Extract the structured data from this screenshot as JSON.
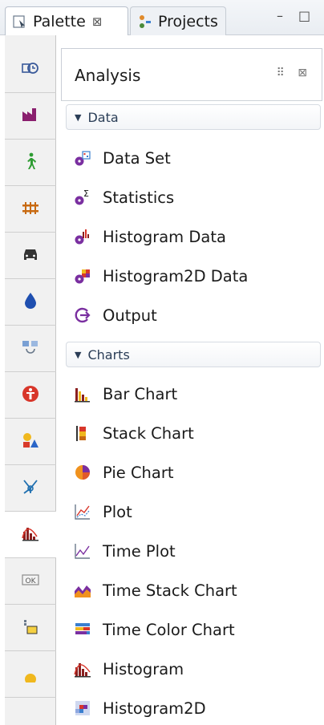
{
  "tabs": {
    "palette": {
      "label": "Palette",
      "close": "⊠"
    },
    "projects": {
      "label": "Projects"
    },
    "minimize": "–",
    "maximize": "□"
  },
  "panel": {
    "title": "Analysis",
    "header_buttons": "⠿ ⊠"
  },
  "sections": [
    {
      "label": "Data",
      "items": [
        {
          "label": "Data Set",
          "icon": "data-set-icon"
        },
        {
          "label": "Statistics",
          "icon": "statistics-icon"
        },
        {
          "label": "Histogram Data",
          "icon": "histogram-data-icon"
        },
        {
          "label": "Histogram2D Data",
          "icon": "histogram2d-data-icon"
        },
        {
          "label": "Output",
          "icon": "output-icon"
        }
      ]
    },
    {
      "label": "Charts",
      "items": [
        {
          "label": "Bar Chart",
          "icon": "bar-chart-icon"
        },
        {
          "label": "Stack Chart",
          "icon": "stack-chart-icon"
        },
        {
          "label": "Pie Chart",
          "icon": "pie-chart-icon"
        },
        {
          "label": "Plot",
          "icon": "plot-icon"
        },
        {
          "label": "Time Plot",
          "icon": "time-plot-icon"
        },
        {
          "label": "Time Stack Chart",
          "icon": "time-stack-chart-icon"
        },
        {
          "label": "Time Color Chart",
          "icon": "time-color-chart-icon"
        },
        {
          "label": "Histogram",
          "icon": "histogram-icon"
        },
        {
          "label": "Histogram2D",
          "icon": "histogram2d-icon"
        }
      ]
    }
  ],
  "strip": [
    {
      "icon": "timer-icon"
    },
    {
      "icon": "factory-icon"
    },
    {
      "icon": "pedestrian-icon"
    },
    {
      "icon": "rail-icon"
    },
    {
      "icon": "car-icon"
    },
    {
      "icon": "fluid-drop-icon"
    },
    {
      "icon": "process-icon"
    },
    {
      "icon": "healthcare-icon"
    },
    {
      "icon": "presentation-icon"
    },
    {
      "icon": "network-icon"
    },
    {
      "icon": "analysis-icon",
      "active": true
    },
    {
      "icon": "controls-icon",
      "text": "OK"
    },
    {
      "icon": "pictures-icon"
    },
    {
      "icon": "more-icon"
    }
  ]
}
